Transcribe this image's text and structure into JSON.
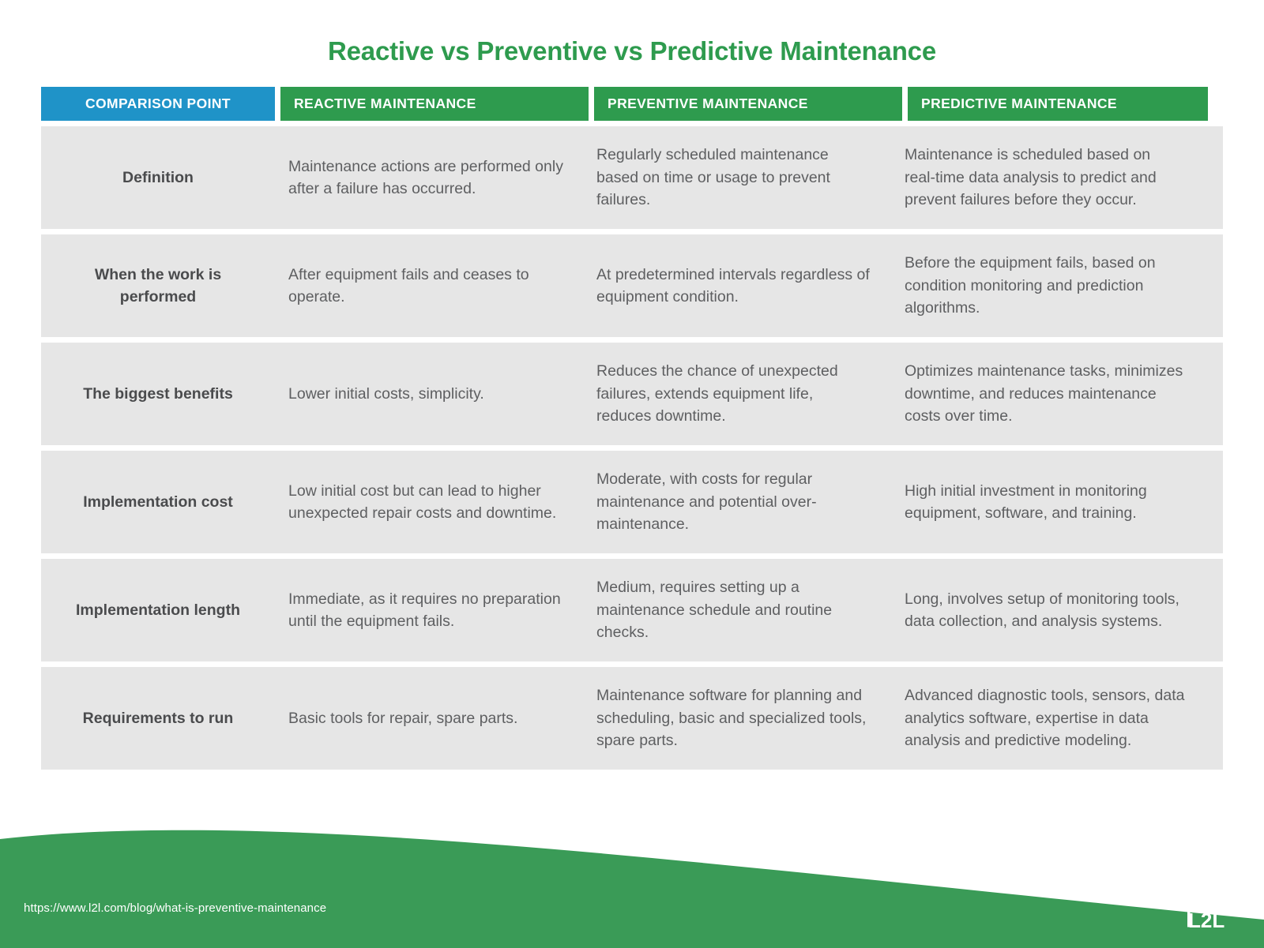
{
  "title": "Reactive vs Preventive vs Predictive Maintenance",
  "colors": {
    "title_green": "#2e9b4e",
    "header_blue": "#1f93c8",
    "header_green": "#2e9b4e",
    "row_gray": "#e6e6e6",
    "body_text": "#5e5f61",
    "footer_green": "#3a9b57"
  },
  "table": {
    "headers": [
      "COMPARISON POINT",
      "REACTIVE MAINTENANCE",
      "PREVENTIVE MAINTENANCE",
      "PREDICTIVE MAINTENANCE"
    ],
    "rows": [
      {
        "label": "Definition",
        "reactive": "Maintenance actions are performed only after a failure has occurred.",
        "preventive": "Regularly scheduled maintenance based on time or usage to prevent failures.",
        "predictive": "Maintenance is scheduled based on real-time data analysis to predict and prevent failures before they occur."
      },
      {
        "label": "When the work is performed",
        "reactive": "After equipment fails and ceases to operate.",
        "preventive": "At predetermined intervals regardless of equipment condition.",
        "predictive": "Before the equipment fails, based on condition monitoring and prediction algorithms."
      },
      {
        "label": "The biggest benefits",
        "reactive": "Lower initial costs, simplicity.",
        "preventive": "Reduces the chance of unexpected failures, extends equipment life, reduces downtime.",
        "predictive": "Optimizes maintenance tasks, minimizes downtime, and reduces maintenance costs over time."
      },
      {
        "label": "Implementation cost",
        "reactive": "Low initial cost but can lead to higher unexpected repair costs and downtime.",
        "preventive": "Moderate, with costs for regular maintenance and potential over-maintenance.",
        "predictive": "High initial investment in monitoring equipment, software, and training."
      },
      {
        "label": "Implementation length",
        "reactive": "Immediate, as it requires no preparation until the equipment fails.",
        "preventive": "Medium, requires setting up a maintenance schedule and routine checks.",
        "predictive": "Long, involves setup of monitoring tools, data collection, and analysis systems."
      },
      {
        "label": "Requirements to run",
        "reactive": "Basic tools for repair, spare parts.",
        "preventive": "Maintenance software for planning and scheduling, basic and specialized tools, spare parts.",
        "predictive": "Advanced diagnostic tools, sensors, data analytics software, expertise in data analysis and predictive modeling."
      }
    ]
  },
  "footer": {
    "url": "https://www.l2l.com/blog/what-is-preventive-maintenance",
    "logo_text": "L2L",
    "logo_icon": "growth-curve-icon"
  }
}
